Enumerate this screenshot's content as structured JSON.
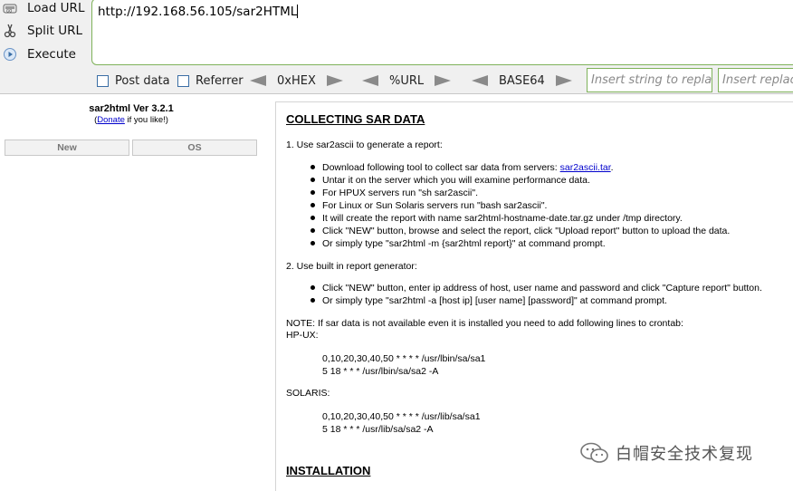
{
  "hackbar": {
    "load_url": "Load URL",
    "split_url": "Split URL",
    "execute": "Execute",
    "url_value": "http://192.168.56.105/sar2HTML",
    "post_data": "Post data",
    "referrer": "Referrer",
    "hex": "0xHEX",
    "url_enc": "%URL",
    "base64": "BASE64",
    "replace_placeholder_1": "Insert string to replace",
    "replace_placeholder_2": "Insert replacing string"
  },
  "sidebar": {
    "title": "sar2html Ver 3.2.1",
    "donate_prefix": "(",
    "donate_link": "Donate",
    "donate_suffix": " if you like!)",
    "tabs": [
      "New",
      "OS"
    ]
  },
  "content": {
    "heading": "COLLECTING SAR DATA",
    "step1": "1. Use sar2ascii to generate a report:",
    "step1_bullets": [
      "Download following tool to collect sar data from servers: ",
      "Untar it on the server which you will examine performance data.",
      "For HPUX servers run \"sh sar2ascii\".",
      "For Linux or Sun Solaris servers run \"bash sar2ascii\".",
      "It will create the report with name sar2html-hostname-date.tar.gz under /tmp directory.",
      "Click \"NEW\" button, browse and select the report, click \"Upload report\" button to upload the data.",
      "Or simply type \"sar2html -m {sar2html report}\" at command prompt."
    ],
    "download_link": "sar2ascii.tar",
    "download_suffix": ".",
    "step2": "2. Use built in report generator:",
    "step2_bullets": [
      "Click \"NEW\" button, enter ip address of host, user name and password and click \"Capture report\" button.",
      "Or simply type \"sar2html -a [host ip] [user name] [password]\" at command prompt."
    ],
    "note": "NOTE: If sar data is not available even it is installed you need to add following lines to crontab:",
    "hpux_label": "HP-UX:",
    "hpux_lines": [
      "0,10,20,30,40,50 * * * * /usr/lbin/sa/sa1",
      "5 18 * * * /usr/lbin/sa/sa2 -A"
    ],
    "solaris_label": "SOLARIS:",
    "solaris_lines": [
      "0,10,20,30,40,50 * * * * /usr/lib/sa/sa1",
      "5 18 * * * /usr/lib/sa/sa2 -A"
    ],
    "install_heading": "INSTALLATION"
  },
  "watermark": "白帽安全技术复现"
}
